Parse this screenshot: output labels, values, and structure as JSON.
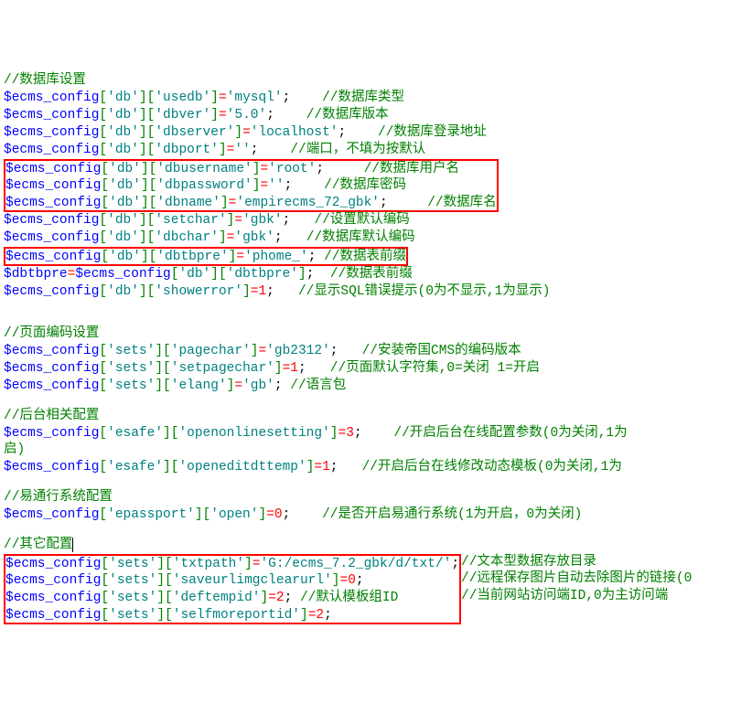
{
  "sections": {
    "db_title": "//数据库设置",
    "db": [
      {
        "k1": "'db'",
        "k2": "'usedb'",
        "v": "'mysql'",
        "c": "//数据库类型"
      },
      {
        "k1": "'db'",
        "k2": "'dbver'",
        "v": "'5.0'",
        "c": "//数据库版本"
      },
      {
        "k1": "'db'",
        "k2": "'dbserver'",
        "v": "'localhost'",
        "c": "//数据库登录地址"
      },
      {
        "k1": "'db'",
        "k2": "'dbport'",
        "v": "''",
        "c": "//端口，不填为按默认"
      }
    ],
    "db_boxed": [
      {
        "k1": "'db'",
        "k2": "'dbusername'",
        "v": "'root'",
        "c": "//数据库用户名"
      },
      {
        "k1": "'db'",
        "k2": "'dbpassword'",
        "v": "''",
        "c": "//数据库密码"
      },
      {
        "k1": "'db'",
        "k2": "'dbname'",
        "v": "'empirecms_72_gbk'",
        "c": "//数据库名"
      }
    ],
    "db2": [
      {
        "k1": "'db'",
        "k2": "'setchar'",
        "v": "'gbk'",
        "c": "//设置默认编码"
      },
      {
        "k1": "'db'",
        "k2": "'dbchar'",
        "v": "'gbk'",
        "c": "//数据库默认编码"
      }
    ],
    "db_boxed2": [
      {
        "k1": "'db'",
        "k2": "'dbtbpre'",
        "v": "'phome_'",
        "c": "//数据表前缀"
      }
    ],
    "dbtbpre_line": {
      "lvar": "$dbtbpre",
      "rvar": "$ecms_config",
      "k1": "'db'",
      "k2": "'dbtbpre'",
      "c": "//数据表前缀"
    },
    "showerror": {
      "k1": "'db'",
      "k2": "'showerror'",
      "v": "1",
      "c": "//显示SQL错误提示(0为不显示,1为显示)"
    },
    "page_title": "//页面编码设置",
    "page": [
      {
        "k1": "'sets'",
        "k2": "'pagechar'",
        "v": "'gb2312'",
        "c": "//安装帝国CMS的编码版本",
        "t": "s"
      },
      {
        "k1": "'sets'",
        "k2": "'setpagechar'",
        "v": "1",
        "c": "//页面默认字符集,0=关闭 1=开启",
        "t": "n"
      },
      {
        "k1": "'sets'",
        "k2": "'elang'",
        "v": "'gb'",
        "c": "//语言包",
        "t": "s"
      }
    ],
    "esafe_title": "//后台相关配置",
    "esafe1": {
      "k1": "'esafe'",
      "k2": "'openonlinesetting'",
      "v": "3",
      "c1": "//开启后台在线配置参数(0为关闭,1为",
      "c2": "启)"
    },
    "esafe2": {
      "k1": "'esafe'",
      "k2": "'openeditdttemp'",
      "v": "1",
      "c": "//开启后台在线修改动态模板(0为关闭,1为"
    },
    "epass_title": "//易通行系统配置",
    "epass": {
      "k1": "'epassport'",
      "k2": "'open'",
      "v": "0",
      "c": "//是否开启易通行系统(1为开启，0为关闭)"
    },
    "other_title": "//其它配置",
    "other_boxed": [
      {
        "k1": "'sets'",
        "k2": "'txtpath'",
        "v": "'G:/ecms_7.2_gbk/d/txt/'",
        "c": "//文本型数据存放目录",
        "t": "s",
        "cout": true
      },
      {
        "k1": "'sets'",
        "k2": "'saveurlimgclearurl'",
        "v": "0",
        "c": "//远程保存图片自动去除图片的链接(0",
        "t": "n",
        "cout": true
      },
      {
        "k1": "'sets'",
        "k2": "'deftempid'",
        "v": "2",
        "c": "//默认模板组ID",
        "t": "n"
      },
      {
        "k1": "'sets'",
        "k2": "'selfmoreportid'",
        "v": "2",
        "c": "//当前网站访问端ID,0为主访问端",
        "t": "n",
        "cout": true
      }
    ]
  },
  "var": "$ecms_config"
}
